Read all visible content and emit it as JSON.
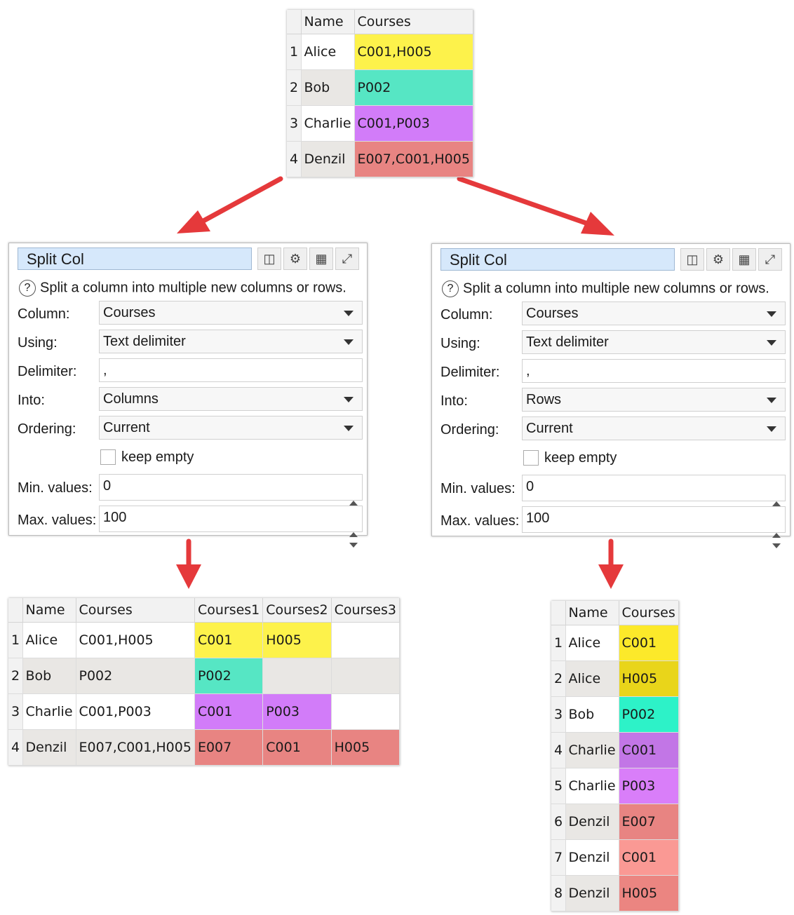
{
  "colors": {
    "yellow": "#fdf24b",
    "teal": "#56e6c4",
    "purple": "#d27cf9",
    "red": "#e88482",
    "yellow2": "#fce92a",
    "yellow3": "#e9d51a",
    "teal2": "#2df2c8",
    "purple2": "#c276e6",
    "purple3": "#d97ef9",
    "red2": "#e88482",
    "red3": "#fa9994",
    "red4": "#eb8581",
    "arrow": "#e5393b",
    "title_bg": "#d6e8fb"
  },
  "input_table": {
    "headers": [
      "Name",
      "Courses"
    ],
    "rows": [
      {
        "n": "1",
        "name": "Alice",
        "courses": "C001,H005"
      },
      {
        "n": "2",
        "name": "Bob",
        "courses": "P002"
      },
      {
        "n": "3",
        "name": "Charlie",
        "courses": "C001,P003"
      },
      {
        "n": "4",
        "name": "Denzil",
        "courses": "E007,C001,H005"
      }
    ]
  },
  "panel_left": {
    "title": "Split Col",
    "description": "Split a column into multiple new columns or rows.",
    "labels": {
      "column": "Column:",
      "using": "Using:",
      "delimiter": "Delimiter:",
      "into": "Into:",
      "ordering": "Ordering:",
      "min": "Min. values:",
      "max": "Max. values:"
    },
    "column": "Courses",
    "using": "Text delimiter",
    "delimiter": ",",
    "into": "Columns",
    "ordering": "Current",
    "keep_empty": "keep empty",
    "min": "0",
    "max": "100"
  },
  "panel_right": {
    "title": "Split Col",
    "description": "Split a column into multiple new columns or rows.",
    "labels": {
      "column": "Column:",
      "using": "Using:",
      "delimiter": "Delimiter:",
      "into": "Into:",
      "ordering": "Ordering:",
      "min": "Min. values:",
      "max": "Max. values:"
    },
    "column": "Courses",
    "using": "Text delimiter",
    "delimiter": ",",
    "into": "Rows",
    "ordering": "Current",
    "keep_empty": "keep empty",
    "min": "0",
    "max": "100"
  },
  "columns_result": {
    "headers": [
      "Name",
      "Courses",
      "Courses1",
      "Courses2",
      "Courses3"
    ],
    "rows": [
      {
        "n": "1",
        "name": "Alice",
        "courses": "C001,H005",
        "c1": "C001",
        "c2": "H005",
        "c3": ""
      },
      {
        "n": "2",
        "name": "Bob",
        "courses": "P002",
        "c1": "P002",
        "c2": "",
        "c3": ""
      },
      {
        "n": "3",
        "name": "Charlie",
        "courses": "C001,P003",
        "c1": "C001",
        "c2": "P003",
        "c3": ""
      },
      {
        "n": "4",
        "name": "Denzil",
        "courses": "E007,C001,H005",
        "c1": "E007",
        "c2": "C001",
        "c3": "H005"
      }
    ]
  },
  "rows_result": {
    "headers": [
      "Name",
      "Courses"
    ],
    "rows": [
      {
        "n": "1",
        "name": "Alice",
        "courses": "C001"
      },
      {
        "n": "2",
        "name": "Alice",
        "courses": "H005"
      },
      {
        "n": "3",
        "name": "Bob",
        "courses": "P002"
      },
      {
        "n": "4",
        "name": "Charlie",
        "courses": "C001"
      },
      {
        "n": "5",
        "name": "Charlie",
        "courses": "P003"
      },
      {
        "n": "6",
        "name": "Denzil",
        "courses": "E007"
      },
      {
        "n": "7",
        "name": "Denzil",
        "courses": "C001"
      },
      {
        "n": "8",
        "name": "Denzil",
        "courses": "H005"
      }
    ]
  }
}
